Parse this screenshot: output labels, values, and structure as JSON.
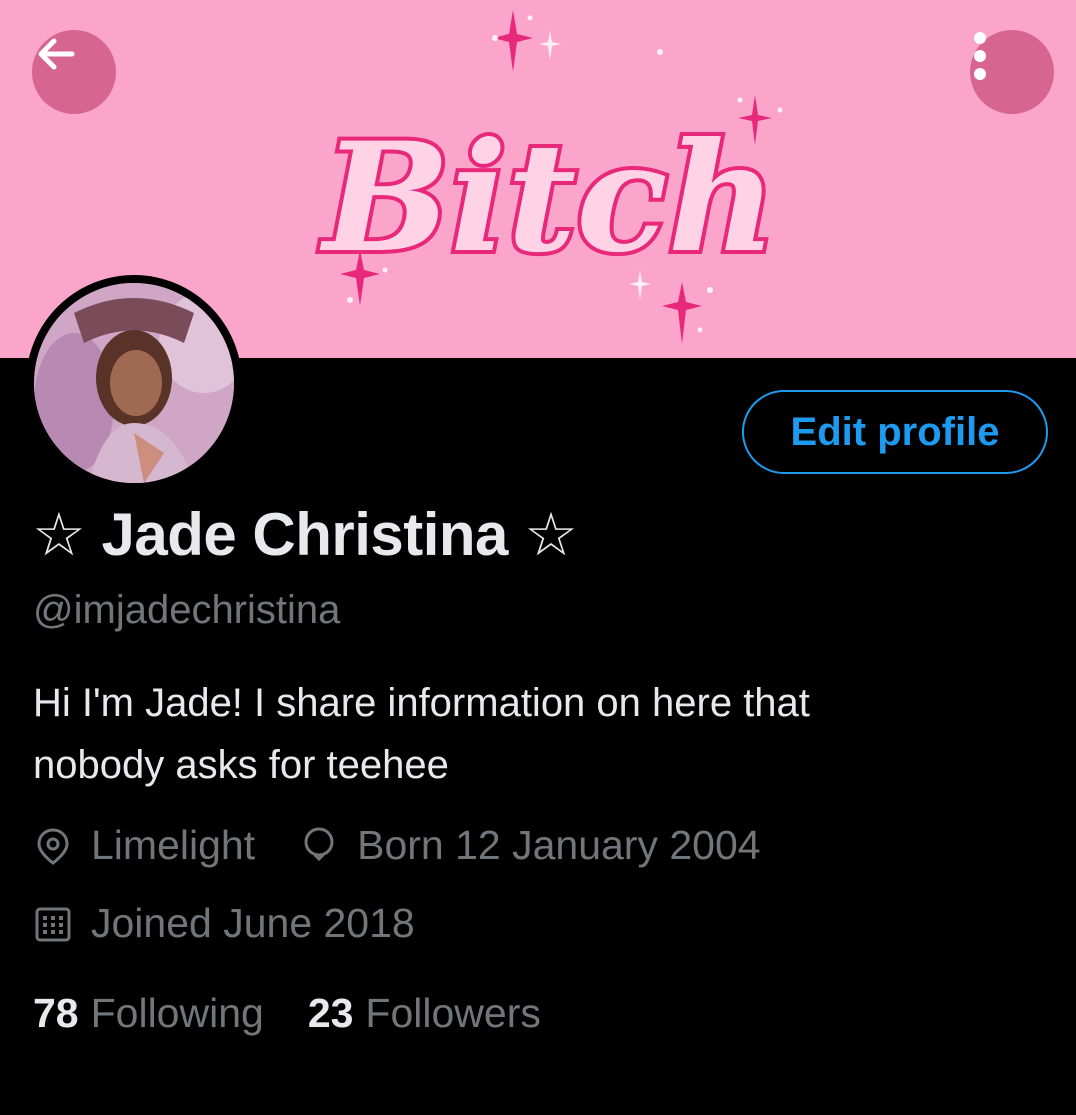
{
  "banner": {
    "text": "Bitch",
    "background": "#fca5cb",
    "text_color": "#e8287a"
  },
  "header": {
    "back_icon": "arrow-left-icon",
    "more_icon": "more-vertical-icon"
  },
  "profile": {
    "edit_label": "Edit profile",
    "display_name": "☆ Jade Christina ☆",
    "handle": "@imjadechristina",
    "bio_line1": "Hi I'm Jade!  I share information on here that",
    "bio_line2": "nobody asks for teehee",
    "location": "Limelight",
    "birthday": "Born 12 January 2004",
    "joined": "Joined June 2018"
  },
  "stats": {
    "following_count": "78",
    "following_label": "Following",
    "followers_count": "23",
    "followers_label": "Followers"
  },
  "colors": {
    "accent": "#1d9bf0",
    "muted": "#71767b",
    "text": "#e7e9ea",
    "background": "#000000"
  }
}
